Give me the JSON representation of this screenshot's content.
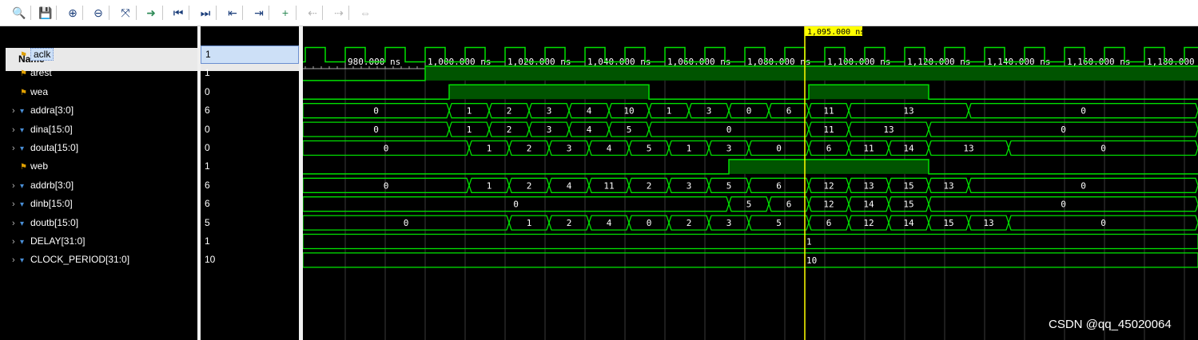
{
  "toolbar": {
    "buttons": [
      {
        "name": "search-icon",
        "glyph": "🔍"
      },
      {
        "name": "save-icon",
        "glyph": "💾"
      },
      {
        "name": "zoom-in-icon",
        "glyph": "⊕"
      },
      {
        "name": "zoom-out-icon",
        "glyph": "⊖"
      },
      {
        "name": "zoom-fit-icon",
        "glyph": "⤧"
      },
      {
        "name": "go-to-cursor-icon",
        "glyph": "➜"
      },
      {
        "name": "go-to-start-icon",
        "glyph": "⏮"
      },
      {
        "name": "go-to-end-icon",
        "glyph": "⏭"
      },
      {
        "name": "previous-transition-icon",
        "glyph": "⇤"
      },
      {
        "name": "next-transition-icon",
        "glyph": "⇥"
      },
      {
        "name": "add-marker-icon",
        "glyph": "+"
      },
      {
        "name": "previous-marker-icon",
        "glyph": "⇠"
      },
      {
        "name": "next-marker-icon",
        "glyph": "⇢"
      },
      {
        "name": "swap-cursors-icon",
        "glyph": "⇔"
      }
    ]
  },
  "columns": {
    "name": "Name",
    "value": "Value"
  },
  "signals": [
    {
      "name": "aclk",
      "value": "1",
      "type": "bit",
      "expandable": false,
      "selected": true
    },
    {
      "name": "arest",
      "value": "1",
      "type": "bit",
      "expandable": false
    },
    {
      "name": "wea",
      "value": "0",
      "type": "bit",
      "expandable": false
    },
    {
      "name": "addra[3:0]",
      "value": "6",
      "type": "bus",
      "expandable": true
    },
    {
      "name": "dina[15:0]",
      "value": "0",
      "type": "bus",
      "expandable": true
    },
    {
      "name": "douta[15:0]",
      "value": "0",
      "type": "bus",
      "expandable": true
    },
    {
      "name": "web",
      "value": "1",
      "type": "bit",
      "expandable": false
    },
    {
      "name": "addrb[3:0]",
      "value": "6",
      "type": "bus",
      "expandable": true
    },
    {
      "name": "dinb[15:0]",
      "value": "6",
      "type": "bus",
      "expandable": true
    },
    {
      "name": "doutb[15:0]",
      "value": "5",
      "type": "bus",
      "expandable": true
    },
    {
      "name": "DELAY[31:0]",
      "value": "1",
      "type": "param",
      "expandable": true
    },
    {
      "name": "CLOCK_PERIOD[31:0]",
      "value": "10",
      "type": "param",
      "expandable": true
    }
  ],
  "timeline": {
    "cursor_label": "1,095.000 ns",
    "cursor_time": 1095,
    "ticks": [
      {
        "t": 980,
        "label": "980.000 ns"
      },
      {
        "t": 1000,
        "label": "1,000.000 ns"
      },
      {
        "t": 1020,
        "label": "1,020.000 ns"
      },
      {
        "t": 1040,
        "label": "1,040.000 ns"
      },
      {
        "t": 1060,
        "label": "1,060.000 ns"
      },
      {
        "t": 1080,
        "label": "1,080.000 ns"
      },
      {
        "t": 1100,
        "label": "1,100.000 ns"
      },
      {
        "t": 1120,
        "label": "1,120.000 ns"
      },
      {
        "t": 1140,
        "label": "1,140.000 ns"
      },
      {
        "t": 1160,
        "label": "1,160.000 ns"
      },
      {
        "t": 1180,
        "label": "1,180.000 n"
      }
    ]
  },
  "waves": {
    "aclk": {
      "kind": "clock",
      "period": 10,
      "first_rise": 970
    },
    "arest": {
      "kind": "bit",
      "edges": [
        [
          965,
          0
        ],
        [
          1000,
          1
        ]
      ]
    },
    "wea": {
      "kind": "bit",
      "edges": [
        [
          965,
          0
        ],
        [
          1006,
          1
        ],
        [
          1056,
          0
        ],
        [
          1096,
          1
        ],
        [
          1126,
          0
        ]
      ]
    },
    "web": {
      "kind": "bit",
      "edges": [
        [
          965,
          0
        ],
        [
          1076,
          1
        ],
        [
          1126,
          0
        ]
      ]
    },
    "addra[3:0]": {
      "kind": "bus",
      "segs": [
        [
          965,
          "0"
        ],
        [
          1006,
          "1"
        ],
        [
          1016,
          "2"
        ],
        [
          1026,
          "3"
        ],
        [
          1036,
          "4"
        ],
        [
          1046,
          "10"
        ],
        [
          1056,
          "1"
        ],
        [
          1066,
          "3"
        ],
        [
          1076,
          "0"
        ],
        [
          1086,
          "6"
        ],
        [
          1096,
          "11"
        ],
        [
          1106,
          "13"
        ],
        [
          1136,
          "0"
        ]
      ]
    },
    "dina[15:0]": {
      "kind": "bus",
      "segs": [
        [
          965,
          "0"
        ],
        [
          1006,
          "1"
        ],
        [
          1016,
          "2"
        ],
        [
          1026,
          "3"
        ],
        [
          1036,
          "4"
        ],
        [
          1046,
          "5"
        ],
        [
          1056,
          "0"
        ],
        [
          1096,
          "11"
        ],
        [
          1106,
          "13"
        ],
        [
          1126,
          "0"
        ]
      ]
    },
    "douta[15:0]": {
      "kind": "bus",
      "segs": [
        [
          965,
          "0"
        ],
        [
          1011,
          "1"
        ],
        [
          1021,
          "2"
        ],
        [
          1031,
          "3"
        ],
        [
          1041,
          "4"
        ],
        [
          1051,
          "5"
        ],
        [
          1061,
          "1"
        ],
        [
          1071,
          "3"
        ],
        [
          1081,
          "0"
        ],
        [
          1096,
          "6"
        ],
        [
          1106,
          "11"
        ],
        [
          1116,
          "14"
        ],
        [
          1126,
          "13"
        ],
        [
          1146,
          "0"
        ]
      ]
    },
    "addrb[3:0]": {
      "kind": "bus",
      "segs": [
        [
          965,
          "0"
        ],
        [
          1011,
          "1"
        ],
        [
          1021,
          "2"
        ],
        [
          1031,
          "4"
        ],
        [
          1041,
          "11"
        ],
        [
          1051,
          "2"
        ],
        [
          1061,
          "3"
        ],
        [
          1071,
          "5"
        ],
        [
          1081,
          "6"
        ],
        [
          1096,
          "12"
        ],
        [
          1106,
          "13"
        ],
        [
          1116,
          "15"
        ],
        [
          1126,
          "13"
        ],
        [
          1136,
          "0"
        ]
      ]
    },
    "dinb[15:0]": {
      "kind": "bus",
      "segs": [
        [
          965,
          "0"
        ],
        [
          1076,
          "5"
        ],
        [
          1086,
          "6"
        ],
        [
          1096,
          "12"
        ],
        [
          1106,
          "14"
        ],
        [
          1116,
          "15"
        ],
        [
          1126,
          "0"
        ]
      ]
    },
    "doutb[15:0]": {
      "kind": "bus",
      "segs": [
        [
          965,
          "0"
        ],
        [
          1021,
          "1"
        ],
        [
          1031,
          "2"
        ],
        [
          1041,
          "4"
        ],
        [
          1051,
          "0"
        ],
        [
          1061,
          "2"
        ],
        [
          1071,
          "3"
        ],
        [
          1081,
          "5"
        ],
        [
          1096,
          "6"
        ],
        [
          1106,
          "12"
        ],
        [
          1116,
          "14"
        ],
        [
          1126,
          "15"
        ],
        [
          1136,
          "13"
        ],
        [
          1146,
          "0"
        ]
      ]
    },
    "DELAY[31:0]": {
      "kind": "const",
      "value": "1"
    },
    "CLOCK_PERIOD[31:0]": {
      "kind": "const",
      "value": "10"
    }
  },
  "watermark": "CSDN @qq_45020064",
  "colors": {
    "wave": "#00e000",
    "fill": "#005400",
    "cursor": "#ffff00",
    "grid": "#3a3a3a",
    "text": "#ffffff"
  }
}
